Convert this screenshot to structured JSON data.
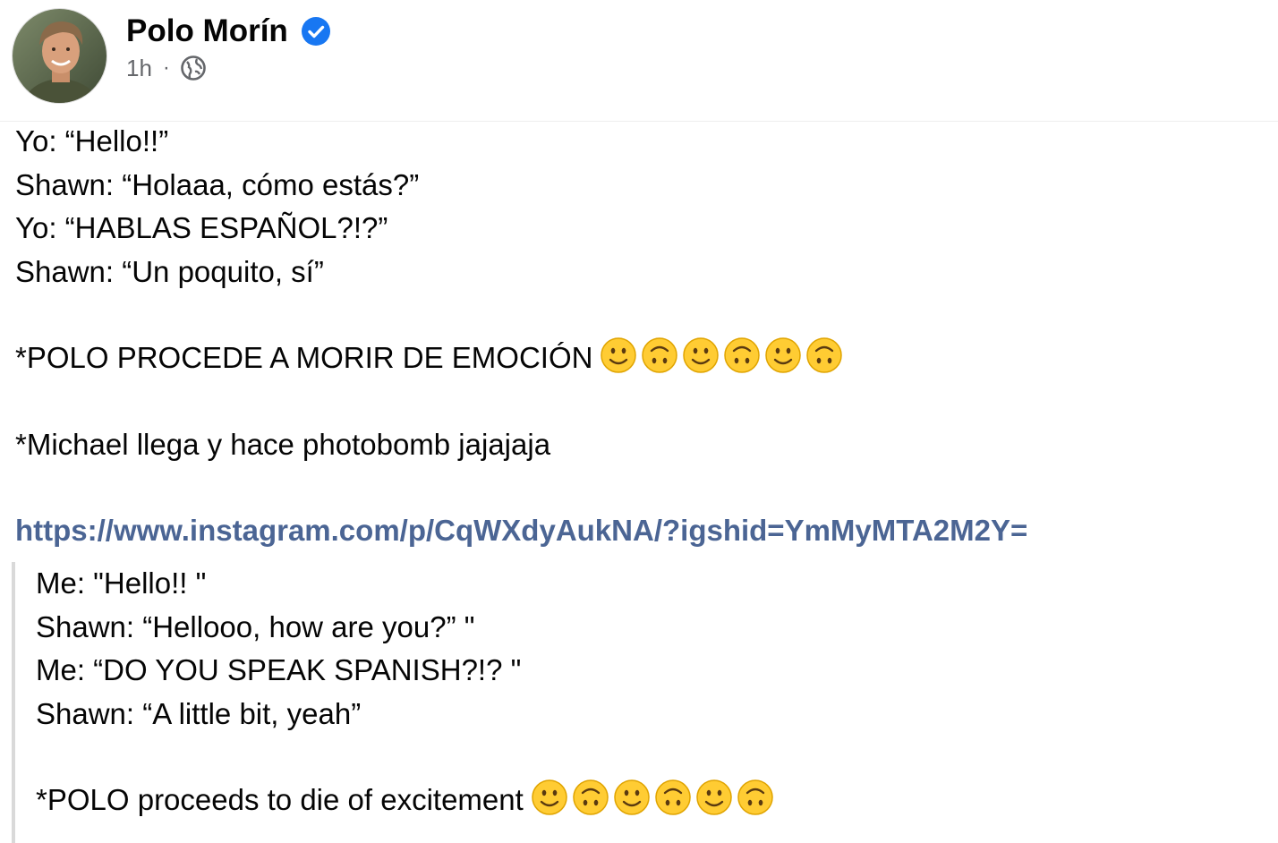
{
  "post": {
    "author": "Polo Morín",
    "time": "1h",
    "separator": "·",
    "verified_icon": "verified-badge-icon",
    "privacy_icon": "globe-icon",
    "colors": {
      "verified": "#1877f2",
      "link": "#4b6594",
      "meta": "#65676b"
    },
    "lines": {
      "l1": "Yo: “Hello!!”",
      "l2": "Shawn: “Holaaa, cómo estás?”",
      "l3": "Yo: “HABLAS ESPAÑOL?!?”",
      "l4": "Shawn: “Un poquito, sí”",
      "l5": "*POLO PROCEDE A MORIR DE EMOCIÓN",
      "l6": "*Michael llega y hace photobomb jajajaja"
    },
    "link": "https://www.instagram.com/p/CqWXdyAukNA/?igshid=YmMyMTA2M2Y=",
    "emojis": [
      "slightly-smiling-face",
      "upside-down-face",
      "slightly-smiling-face",
      "upside-down-face",
      "slightly-smiling-face",
      "upside-down-face"
    ]
  },
  "quote": {
    "lines": {
      "q1": "Me: \"Hello!! \"",
      "q2": "Shawn: “Hellooo, how are you?” \"",
      "q3": "Me: “DO YOU SPEAK SPANISH?!? \"",
      "q4": "Shawn: “A little bit, yeah”",
      "q5": "*POLO proceeds to die of excitement"
    }
  }
}
